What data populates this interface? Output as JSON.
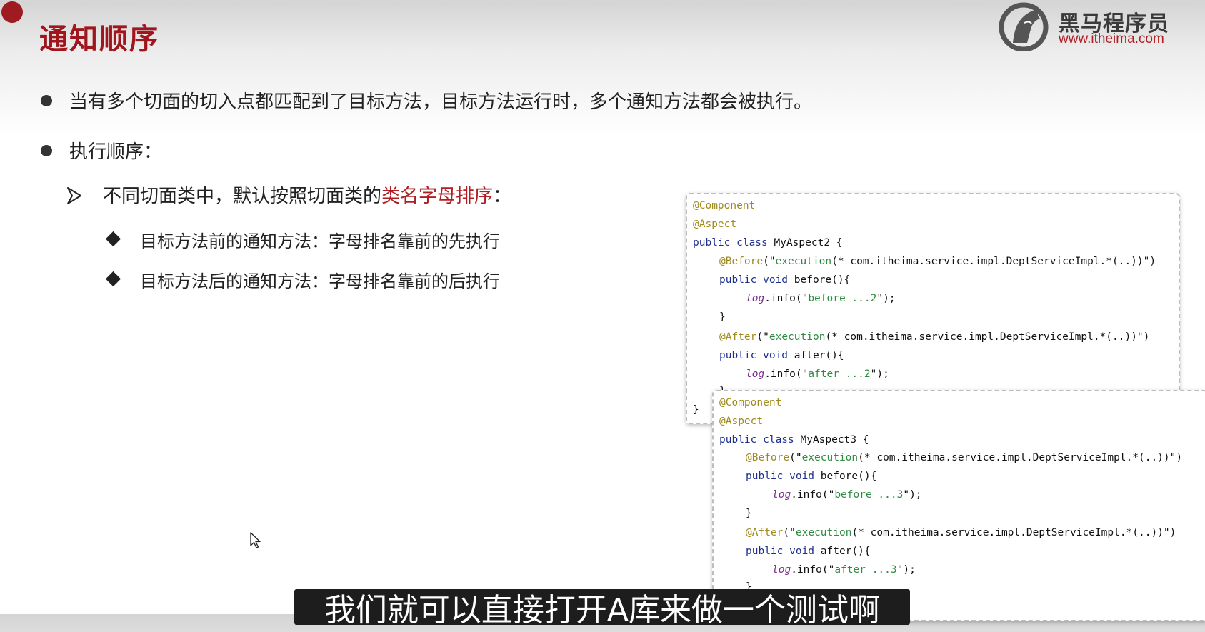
{
  "slide": {
    "title": "通知顺序",
    "logo": {
      "name": "黑马程序员",
      "url": "www.itheima.com",
      "icon": "horse-head-icon"
    },
    "accent_color": "#a0161d"
  },
  "bullets": [
    {
      "text": "当有多个切面的切入点都匹配到了目标方法，目标方法运行时，多个通知方法都会被执行。"
    },
    {
      "text": "执行顺序："
    }
  ],
  "sub_point": {
    "prefix": "不同切面类中，默认按照切面类的",
    "highlight": "类名字母排序",
    "suffix": "："
  },
  "details": [
    {
      "text": "目标方法前的通知方法：字母排名靠前的先执行"
    },
    {
      "text": "目标方法后的通知方法：字母排名靠前的后执行"
    }
  ],
  "code_aspect2": {
    "l1": "@Component",
    "l2": "@Aspect",
    "l3_kw": "public class",
    "l3_name": " MyAspect2 {",
    "l4_ann": "@Before",
    "l4_a": "(\"",
    "l4_str": "execution",
    "l4_b": "(* com.itheima.service.impl.DeptServiceImpl.*(..))\")",
    "l5_kw": "public void",
    "l5_rest": " before(){",
    "l6_log": "log",
    "l6_a": ".info(\"",
    "l6_str": "before ...2",
    "l6_b": "\");",
    "l7": "}",
    "l8_ann": "@After",
    "l8_a": "(\"",
    "l8_str": "execution",
    "l8_b": "(* com.itheima.service.impl.DeptServiceImpl.*(..))\")",
    "l9_kw": "public void",
    "l9_rest": " after(){",
    "l10_log": "log",
    "l10_a": ".info(\"",
    "l10_str": "after ...2",
    "l10_b": "\");",
    "l11": "}",
    "l12": "}"
  },
  "code_aspect3": {
    "l1": "@Component",
    "l2": "@Aspect",
    "l3_kw": "public class",
    "l3_name": " MyAspect3 {",
    "l4_ann": "@Before",
    "l4_a": "(\"",
    "l4_str": "execution",
    "l4_b": "(* com.itheima.service.impl.DeptServiceImpl.*(..))\")",
    "l5_kw": "public void",
    "l5_rest": " before(){",
    "l6_log": "log",
    "l6_a": ".info(\"",
    "l6_str": "before ...3",
    "l6_b": "\");",
    "l7": "}",
    "l8_ann": "@After",
    "l8_a": "(\"",
    "l8_str": "execution",
    "l8_b": "(* com.itheima.service.impl.DeptServiceImpl.*(..))\")",
    "l9_kw": "public void",
    "l9_rest": " after(){",
    "l10_log": "log",
    "l10_a": ".info(\"",
    "l10_str": "after ...3",
    "l10_b": "\");",
    "l11": "}"
  },
  "subtitle": {
    "text": "我们就可以直接打开A库来做一个测试啊"
  }
}
